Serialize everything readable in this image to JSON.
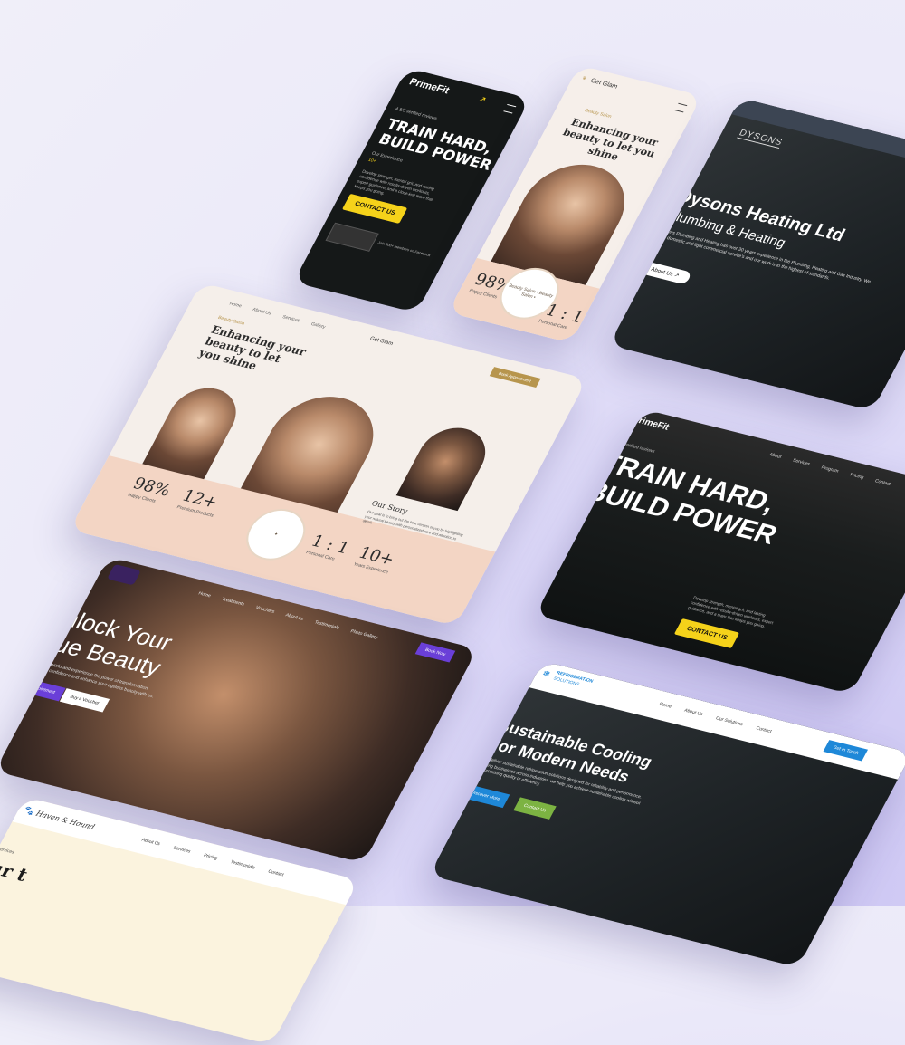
{
  "primefit_mobile": {
    "logo": "PrimeFit",
    "rating": "4.8/5 verified reviews",
    "headline1": "TRAIN HARD,",
    "headline2": "BUILD POWER",
    "sub": "Our Experience",
    "years": "10+",
    "body": "Develop strength, mental grit, and lasting confidence with results-driven workouts, expert guidance, and a close-knit team that keeps you going.",
    "cta": "CONTACT US",
    "avatars_text": "Join 500+ members on Facebook"
  },
  "getglam_mobile": {
    "logo": "Get Glam",
    "tag": "Beauty Salon",
    "headline": "Enhancing your beauty to let you shine",
    "stat1_num": "98%",
    "stat1_lbl": "Happy Clients",
    "stat2_num": "1 : 1",
    "stat2_lbl": "Personal Care",
    "badge": "Beauty Salon • Beauty Salon •"
  },
  "dysons": {
    "logo": "DYSONS",
    "title": "Dysons Heating Ltd",
    "subtitle": "Plumbing & Heating",
    "body": "Dysons Plumbing and Heating has over 30 years experience in the Plumbing, Heating and Gas Industry. We offer domestic and light commercial service's and our work is to the highest of standards.",
    "cta": "About Us"
  },
  "getglam_desktop": {
    "logo": "Get Glam",
    "nav": [
      "Home",
      "About Us",
      "Services",
      "Gallery"
    ],
    "tag": "Beauty Salon",
    "headline": "Enhancing your beauty to let you shine",
    "cta": "Book Appointment",
    "stat1_num": "98%",
    "stat1_lbl": "Happy Clients",
    "stat2_num": "12+",
    "stat2_lbl": "Premium Products",
    "stat3_num": "1 : 1",
    "stat3_lbl": "Personal Care",
    "stat4_num": "10+",
    "stat4_lbl": "Years Experience",
    "story_title": "Our Story",
    "story_body": "Our goal is to bring out the best version of you by highlighting your natural beauty with personalized care and attention to detail.",
    "story_link": "Learn more"
  },
  "primefit_desktop": {
    "logo": "PrimeFit",
    "nav": [
      "About",
      "Services",
      "Program",
      "Pricing",
      "Contact"
    ],
    "rating": "4.8/5 verified reviews",
    "headline1": "TRAIN HARD,",
    "headline2": "BUILD POWER",
    "body": "Develop strength, mental grit, and lasting confidence with results-driven workouts, expert guidance, and a team that keeps you going.",
    "cta": "CONTACT US"
  },
  "salon": {
    "nav": [
      "Home",
      "Treatments",
      "Vouchers",
      "About us",
      "Testimonials",
      "Photo Gallery"
    ],
    "cta_nav": "Book Now",
    "headline1": "Unlock Your",
    "headline2": "True Beauty",
    "body": "Step into our world and experience the power of transformation. Unleash your confidence and enhance your ageless beauty with us.",
    "btn1": "Book Appointment",
    "btn2": "Buy a Voucher"
  },
  "refrigeration": {
    "logo1": "REFRIGERATION",
    "logo2": "SOLUTIONS",
    "nav": [
      "Home",
      "About Us",
      "Our Solutions",
      "Contact"
    ],
    "nav_cta": "Get In Touch",
    "headline1": "Sustainable Cooling",
    "headline2": "For Modern Needs",
    "body": "We deliver sustainable refrigeration solutions designed for reliability and performance. Serving businesses across industries, we help you achieve sustainable cooling without compromising quality or efficiency.",
    "btn1": "Discover More",
    "btn2": "Contact Us"
  },
  "haven": {
    "logo": "Haven & Hound",
    "nav": [
      "About Us",
      "Services",
      "Pricing",
      "Testimonials",
      "Contact"
    ],
    "tag": "Pet care services",
    "headline": "Your t"
  },
  "colors": {
    "gym_yellow": "#f5d21a",
    "glam_beige": "#f3ebe4",
    "glam_peach": "#f3d5c4",
    "salon_purple": "#6a3fd8",
    "cool_blue": "#1e88d8",
    "cool_green": "#7cb342",
    "navy": "#2b3442"
  }
}
